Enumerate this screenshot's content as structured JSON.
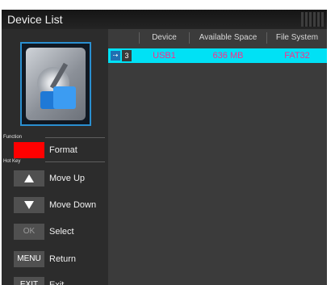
{
  "window": {
    "title": "Device List"
  },
  "sidebar": {
    "function_label": "Function",
    "hotkey_label": "Hot Key",
    "function_key": {
      "color": "#ff0000",
      "label": "Format"
    },
    "keys": [
      {
        "icon": "up-arrow-icon",
        "label": "Move Up"
      },
      {
        "icon": "down-arrow-icon",
        "label": "Move Down"
      },
      {
        "key": "OK",
        "label": "Select"
      },
      {
        "key": "MENU",
        "label": "Return"
      },
      {
        "key": "EXIT",
        "label": "Exit"
      }
    ]
  },
  "table": {
    "columns": [
      "Device",
      "Available Space",
      "File System"
    ],
    "rows": [
      {
        "icon": "usb-icon",
        "slot": "3",
        "device": "USB1",
        "space": "636 MB",
        "fs": "FAT32"
      }
    ]
  },
  "colors": {
    "accent": "#00e1f5",
    "selected_text": "#ff2b8a",
    "function_red": "#ff0000"
  }
}
